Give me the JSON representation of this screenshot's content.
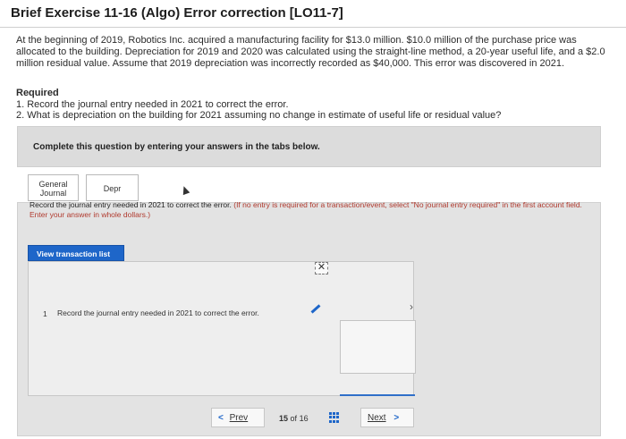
{
  "header": {
    "title": "Brief Exercise 11-16 (Algo) Error correction [LO11-7]"
  },
  "problem": {
    "text": "At the beginning of 2019, Robotics Inc. acquired a manufacturing facility for $13.0 million. $10.0 million of the purchase price was allocated to the building. Depreciation for 2019 and 2020 was calculated using the straight-line method, a 20-year useful life, and a $2.0 million residual value. Assume that 2019 depreciation was incorrectly recorded as $40,000. This error was discovered in 2021."
  },
  "required": {
    "heading": "Required",
    "item1": "1. Record the journal entry needed in 2021 to correct the error.",
    "item2": "2. What is depreciation on the building for 2021 assuming no change in estimate of useful life or residual value?"
  },
  "panel": {
    "complete_label": "Complete this question by entering your answers in the tabs below."
  },
  "tabs": [
    {
      "label_line1": "General",
      "label_line2": "Journal"
    },
    {
      "label": "Depr"
    }
  ],
  "instruction": {
    "main": "Record the journal entry needed in 2021 to correct the error.",
    "note": "(If no entry is required for a transaction/event, select \"No journal entry required\" in the first account field. Enter your answer in whole dollars.)"
  },
  "actions": {
    "view_transaction_list": "View transaction list"
  },
  "transaction": {
    "number": "1",
    "text": "Record the journal entry needed in 2021 to correct the error."
  },
  "pagination": {
    "prev_label": "Prev",
    "current": "15",
    "of_label": "of",
    "total": "16",
    "next_label": "Next"
  },
  "icons": {
    "close": "close-icon",
    "pencil": "pencil-icon",
    "chevron_right": "chevron-right-icon",
    "grid": "grid-icon"
  },
  "colors": {
    "accent": "#1e66c9",
    "panel_bg": "#e3e3e3",
    "note_text": "#b03a2e"
  }
}
